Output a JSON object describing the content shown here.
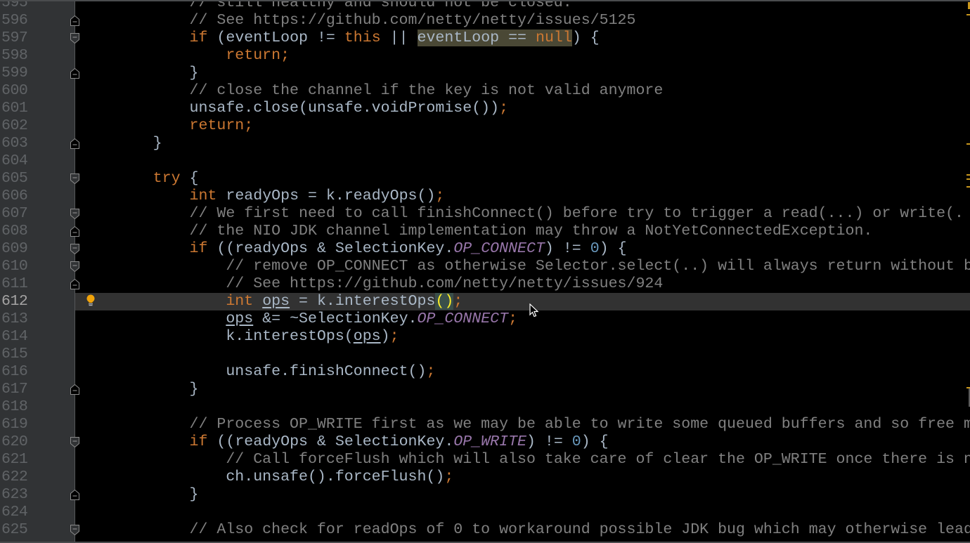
{
  "editor": {
    "current_line": "612",
    "lightbulb_line": "612",
    "lines": [
      {
        "n": "595",
        "fold": "",
        "code": [
          [
            "            ",
            ""
          ],
          [
            "// still healthy and should not be closed.",
            "cm"
          ]
        ]
      },
      {
        "n": "596",
        "fold": "end",
        "code": [
          [
            "            ",
            ""
          ],
          [
            "// See https://github.com/netty/netty/issues/5125",
            "cm"
          ]
        ]
      },
      {
        "n": "597",
        "fold": "start",
        "code": [
          [
            "            ",
            ""
          ],
          [
            "if",
            "kw"
          ],
          [
            " (eventLoop != ",
            "id"
          ],
          [
            "this",
            "kw"
          ],
          [
            " || ",
            "id"
          ],
          [
            "eventLoop == ",
            "id",
            "usage"
          ],
          [
            "null",
            "kw",
            "usage"
          ],
          [
            ") {",
            "id"
          ]
        ]
      },
      {
        "n": "598",
        "fold": "",
        "code": [
          [
            "                ",
            ""
          ],
          [
            "return",
            "kw"
          ],
          [
            ";",
            "semi"
          ]
        ]
      },
      {
        "n": "599",
        "fold": "end",
        "code": [
          [
            "            ",
            ""
          ],
          [
            "}",
            "id"
          ]
        ]
      },
      {
        "n": "600",
        "fold": "",
        "code": [
          [
            "            ",
            ""
          ],
          [
            "// close the channel if the key is not valid anymore",
            "cm"
          ]
        ]
      },
      {
        "n": "601",
        "fold": "",
        "code": [
          [
            "            ",
            ""
          ],
          [
            "unsafe.close(unsafe.voidPromise())",
            "id"
          ],
          [
            ";",
            "semi"
          ]
        ]
      },
      {
        "n": "602",
        "fold": "",
        "code": [
          [
            "            ",
            ""
          ],
          [
            "return",
            "kw"
          ],
          [
            ";",
            "semi"
          ]
        ]
      },
      {
        "n": "603",
        "fold": "end",
        "code": [
          [
            "        ",
            ""
          ],
          [
            "}",
            "id"
          ]
        ]
      },
      {
        "n": "604",
        "fold": "",
        "code": []
      },
      {
        "n": "605",
        "fold": "start",
        "code": [
          [
            "        ",
            ""
          ],
          [
            "try",
            "kw"
          ],
          [
            " {",
            "id"
          ]
        ]
      },
      {
        "n": "606",
        "fold": "",
        "code": [
          [
            "            ",
            ""
          ],
          [
            "int",
            "kw"
          ],
          [
            " readyOps = k.readyOps()",
            "id"
          ],
          [
            ";",
            "semi"
          ]
        ]
      },
      {
        "n": "607",
        "fold": "start",
        "code": [
          [
            "            ",
            ""
          ],
          [
            "// We first need to call finishConnect() before try to trigger a read(...) or write(.",
            "cm"
          ]
        ]
      },
      {
        "n": "608",
        "fold": "end",
        "code": [
          [
            "            ",
            ""
          ],
          [
            "// the NIO JDK channel implementation may throw a NotYetConnectedException.",
            "cm"
          ]
        ]
      },
      {
        "n": "609",
        "fold": "start",
        "code": [
          [
            "            ",
            ""
          ],
          [
            "if",
            "kw"
          ],
          [
            " ((readyOps & SelectionKey.",
            "id"
          ],
          [
            "OP_CONNECT",
            "const"
          ],
          [
            ") != ",
            "id"
          ],
          [
            "0",
            "num"
          ],
          [
            ") {",
            "id"
          ]
        ]
      },
      {
        "n": "610",
        "fold": "start",
        "code": [
          [
            "                ",
            ""
          ],
          [
            "// remove OP_CONNECT as otherwise Selector.select(..) will always return without b",
            "cm"
          ]
        ]
      },
      {
        "n": "611",
        "fold": "end",
        "code": [
          [
            "                ",
            ""
          ],
          [
            "// See https://github.com/netty/netty/issues/924",
            "cm"
          ]
        ]
      },
      {
        "n": "612",
        "fold": "",
        "code": [
          [
            "                ",
            ""
          ],
          [
            "int",
            "kw"
          ],
          [
            " ",
            "id"
          ],
          [
            "ops",
            "id",
            "underline"
          ],
          [
            " = k.interestOps",
            "id"
          ],
          [
            "(",
            "id",
            "match"
          ],
          [
            ")",
            "id",
            "match"
          ],
          [
            ";",
            "semi"
          ]
        ]
      },
      {
        "n": "613",
        "fold": "",
        "code": [
          [
            "                ",
            ""
          ],
          [
            "ops",
            "id",
            "underline"
          ],
          [
            " &= ~SelectionKey.",
            "id"
          ],
          [
            "OP_CONNECT",
            "const"
          ],
          [
            ";",
            "semi"
          ]
        ]
      },
      {
        "n": "614",
        "fold": "",
        "code": [
          [
            "                ",
            ""
          ],
          [
            "k.interestOps(",
            "id"
          ],
          [
            "ops",
            "id",
            "underline"
          ],
          [
            ")",
            "id"
          ],
          [
            ";",
            "semi"
          ]
        ]
      },
      {
        "n": "615",
        "fold": "",
        "code": []
      },
      {
        "n": "616",
        "fold": "",
        "code": [
          [
            "                ",
            ""
          ],
          [
            "unsafe.finishConnect()",
            "id"
          ],
          [
            ";",
            "semi"
          ]
        ]
      },
      {
        "n": "617",
        "fold": "end",
        "code": [
          [
            "            ",
            ""
          ],
          [
            "}",
            "id"
          ]
        ]
      },
      {
        "n": "618",
        "fold": "",
        "code": []
      },
      {
        "n": "619",
        "fold": "",
        "code": [
          [
            "            ",
            ""
          ],
          [
            "// Process OP_WRITE first as we may be able to write some queued buffers and so free m",
            "cm"
          ]
        ]
      },
      {
        "n": "620",
        "fold": "start",
        "code": [
          [
            "            ",
            ""
          ],
          [
            "if",
            "kw"
          ],
          [
            " ((readyOps & SelectionKey.",
            "id"
          ],
          [
            "OP_WRITE",
            "const"
          ],
          [
            ") != ",
            "id"
          ],
          [
            "0",
            "num"
          ],
          [
            ") {",
            "id"
          ]
        ]
      },
      {
        "n": "621",
        "fold": "",
        "code": [
          [
            "                ",
            ""
          ],
          [
            "// Call forceFlush which will also take care of clear the OP_WRITE once there is n",
            "cm"
          ]
        ]
      },
      {
        "n": "622",
        "fold": "",
        "code": [
          [
            "                ",
            ""
          ],
          [
            "ch.unsafe().forceFlush()",
            "id"
          ],
          [
            ";",
            "semi"
          ]
        ]
      },
      {
        "n": "623",
        "fold": "end",
        "code": [
          [
            "            ",
            ""
          ],
          [
            "}",
            "id"
          ]
        ]
      },
      {
        "n": "624",
        "fold": "",
        "code": []
      },
      {
        "n": "625",
        "fold": "start",
        "code": [
          [
            "            ",
            ""
          ],
          [
            "// Also check for readOps of 0 to workaround possible JDK bug which may otherwise lead",
            "cm"
          ]
        ]
      }
    ]
  },
  "colors": {
    "keyword": "#cc7832",
    "comment": "#808080",
    "constant": "#9876aa",
    "number": "#6897bb",
    "identifier": "#a9b7c6",
    "current_line_bg": "#323232",
    "gutter_bg": "#313335",
    "stripe_mark": "#c9971d"
  }
}
